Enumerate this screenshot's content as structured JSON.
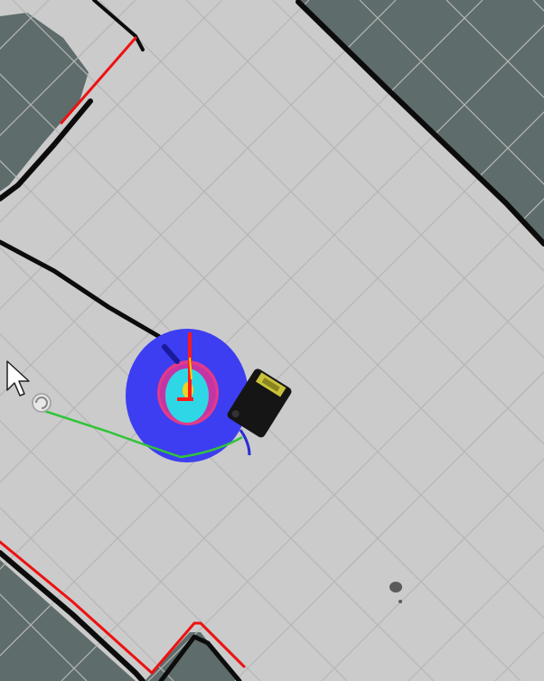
{
  "colors": {
    "free_space": "#cbcbcb",
    "unknown_space": "#5e6c6b",
    "grid_line": "#b4b4b4",
    "occupied_wall": "#0c0c0c",
    "laser_scan": "#ee1111",
    "costmap_outer": "#3d3df2",
    "costmap_mid": "#e23a8a",
    "costmap_core": "#2fd6e6",
    "costmap_center": "#f2d21e",
    "global_plan": "#31c43a",
    "local_plan": "#2a2ad6",
    "robot_body": "#151515",
    "robot_top_panel": "#c9c23a",
    "axis_x": "#ff1a1a",
    "axis_y": "#ffd000",
    "cursor": "#ffffff"
  },
  "icons": {
    "cursor": "mouse-cursor-arrow",
    "goal_marker": "rotate-goal-marker"
  }
}
